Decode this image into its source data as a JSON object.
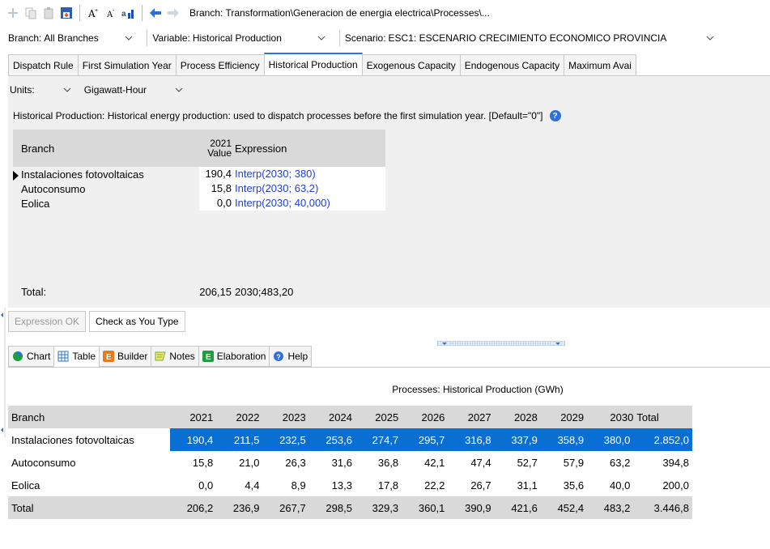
{
  "toolbar": {
    "breadcrumb": "Branch: Transformation\\Generacion de energia electrica\\Processes\\..."
  },
  "selectors": {
    "branch_label": "Branch:",
    "branch_value": "All Branches",
    "variable_label": "Variable:",
    "variable_value": "Historical Production",
    "scenario_label": "Scenario:",
    "scenario_value": "ESC1: ESCENARIO CRECIMIENTO ECONOMICO PROVINCIA"
  },
  "property_tabs": [
    "Dispatch Rule",
    "First Simulation Year",
    "Process Efficiency",
    "Historical Production",
    "Exogenous Capacity",
    "Endogenous Capacity",
    "Maximum Avai"
  ],
  "units": {
    "label": "Units:",
    "scale": "",
    "unit": "Gigawatt-Hour"
  },
  "description": "Historical Production: Historical energy production: used to dispatch processes before the first simulation year. [Default=\"0\"]",
  "expression_grid": {
    "col_branch": "Branch",
    "col_year": "2021",
    "col_value": "Value",
    "col_expression": "Expression",
    "rows": [
      {
        "branch": "Instalaciones fotovoltaicas",
        "value": "190,4",
        "expression": "Interp(2030; 380)"
      },
      {
        "branch": "Autoconsumo",
        "value": "15,8",
        "expression": "Interp(2030; 63,2)"
      },
      {
        "branch": "Eolica",
        "value": "0,0",
        "expression": "Interp(2030; 40,000)"
      }
    ],
    "total_label": "Total:",
    "total_value": "206,15",
    "total_expression": "2030;483,20"
  },
  "status": {
    "expression_ok": "Expression OK",
    "check_as_you_type": "Check as You Type"
  },
  "bottom_tabs": [
    "Chart",
    "Table",
    "Builder",
    "Notes",
    "Elaboration",
    "Help"
  ],
  "table": {
    "title": "Processes: Historical Production (GWh)",
    "header_branch": "Branch",
    "years": [
      "2021",
      "2022",
      "2023",
      "2024",
      "2025",
      "2026",
      "2027",
      "2028",
      "2029",
      "2030"
    ],
    "header_total": "Total",
    "rows": [
      {
        "name": "Instalaciones fotovoltaicas",
        "values": [
          "190,4",
          "211,5",
          "232,5",
          "253,6",
          "274,7",
          "295,7",
          "316,8",
          "337,9",
          "358,9",
          "380,0"
        ],
        "total": "2.852,0"
      },
      {
        "name": "Autoconsumo",
        "values": [
          "15,8",
          "21,0",
          "26,3",
          "31,6",
          "36,8",
          "42,1",
          "47,4",
          "52,7",
          "57,9",
          "63,2"
        ],
        "total": "394,8"
      },
      {
        "name": "Eolica",
        "values": [
          "0,0",
          "4,4",
          "8,9",
          "13,3",
          "17,8",
          "22,2",
          "26,7",
          "31,1",
          "35,6",
          "40,0"
        ],
        "total": "200,0"
      }
    ],
    "total_row": {
      "name": "Total",
      "values": [
        "206,2",
        "236,9",
        "267,7",
        "298,5",
        "329,3",
        "360,1",
        "390,9",
        "421,6",
        "452,4",
        "483,2"
      ],
      "total": "3.446,8"
    }
  },
  "colors": {
    "selection": "#0a6fd3",
    "active_tab_accent": "#1e7bd6",
    "expression_text": "#1f3fd6",
    "header_bg": "#d9d9d9"
  }
}
